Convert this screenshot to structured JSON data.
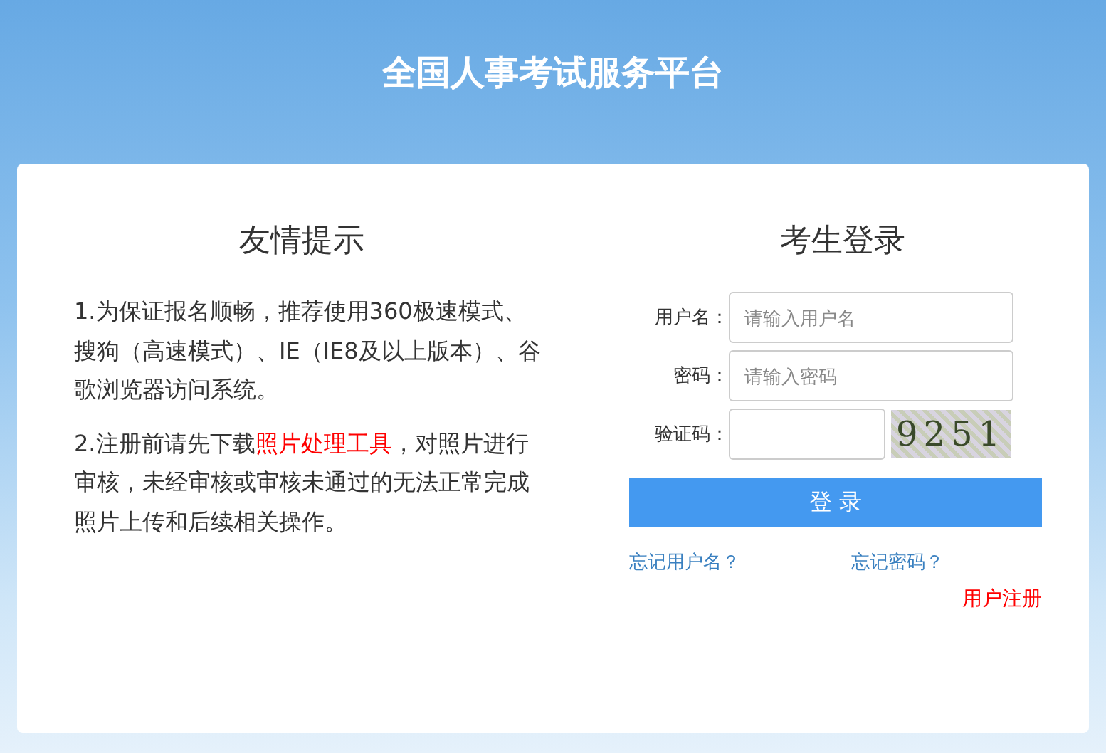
{
  "page_title": "全国人事考试服务平台",
  "tips": {
    "heading": "友情提示",
    "paragraphs": [
      [
        {
          "kind": "plain",
          "text": "1.为保证报名顺畅，推荐使用360极速模式、搜狗（高速模式）、IE（IE8及以上版本）、谷歌浏览器访问系统。"
        }
      ],
      [
        {
          "kind": "plain",
          "text": "2.注册前请先下载"
        },
        {
          "kind": "link",
          "text": "照片处理工具"
        },
        {
          "kind": "plain",
          "text": "，对照片进行审核，未经审核或审核未通过的无法正常完成照片上传和后续相关操作。"
        }
      ]
    ]
  },
  "login": {
    "heading": "考生登录",
    "fields": [
      {
        "kind": "text",
        "label": "用户名：",
        "placeholder": "请输入用户名"
      },
      {
        "kind": "password",
        "label": "密码：",
        "placeholder": "请输入密码"
      },
      {
        "kind": "captcha",
        "label": "验证码：",
        "code": "9251"
      }
    ],
    "button": "登 录",
    "links": [
      "忘记用户名？",
      "忘记密码？"
    ],
    "register": "用户注册"
  }
}
